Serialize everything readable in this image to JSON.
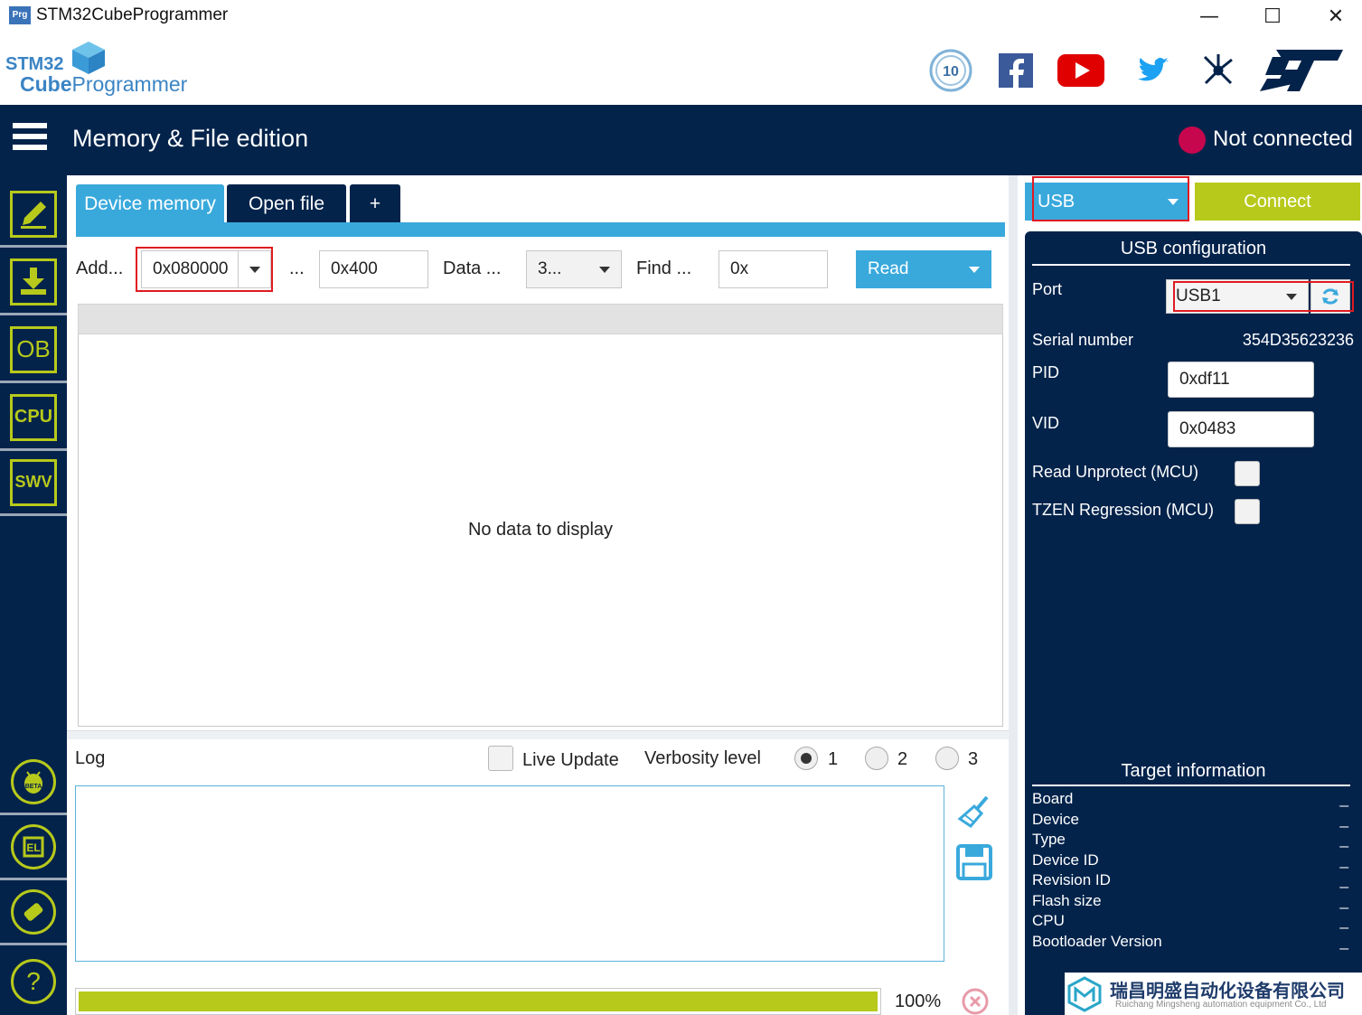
{
  "window": {
    "app_icon_text": "Prg",
    "title": "STM32CubeProgrammer",
    "minimize": "—",
    "maximize": "☐",
    "close": "✕"
  },
  "brand": {
    "logo_stm32": "STM32",
    "logo_cube": "Cube",
    "logo_programmer": "Programmer"
  },
  "header": {
    "page_title": "Memory & File edition",
    "status": "Not connected",
    "status_color": "#c7074d"
  },
  "tabs": [
    {
      "label": "Device memory",
      "active": true
    },
    {
      "label": "Open file",
      "active": false
    },
    {
      "label": "+",
      "active": false
    }
  ],
  "toolbar": {
    "address_label": "Add...",
    "address_value": "0x080000",
    "size_label": "...",
    "size_value": "0x400",
    "data_width_label": "Data ...",
    "data_width_value": "3...",
    "find_label": "Find ...",
    "find_value": "0x",
    "read_button": "Read"
  },
  "memory_view": {
    "empty_message": "No data to display"
  },
  "log": {
    "title": "Log",
    "live_update_label": "Live Update",
    "verbosity_label": "Verbosity level",
    "verbosity_options": [
      "1",
      "2",
      "3"
    ],
    "verbosity_selected": "1",
    "progress_percent_label": "100%",
    "progress_fraction": 1.0
  },
  "connection": {
    "interface": "USB",
    "connect_button": "Connect",
    "config_title": "USB configuration",
    "port_label": "Port",
    "port_value": "USB1",
    "serial_label": "Serial number",
    "serial_value": "354D35623236",
    "pid_label": "PID",
    "pid_value": "0xdf11",
    "vid_label": "VID",
    "vid_value": "0x0483",
    "read_unprotect_label": "Read Unprotect (MCU)",
    "tzen_label": "TZEN Regression (MCU)"
  },
  "target": {
    "title": "Target information",
    "rows": [
      {
        "label": "Board",
        "value": "_"
      },
      {
        "label": "Device",
        "value": "_"
      },
      {
        "label": "Type",
        "value": "_"
      },
      {
        "label": "Device ID",
        "value": "_"
      },
      {
        "label": "Revision ID",
        "value": "_"
      },
      {
        "label": "Flash size",
        "value": "_"
      },
      {
        "label": "CPU",
        "value": "_"
      },
      {
        "label": "Bootloader Version",
        "value": "_"
      }
    ]
  },
  "sidebar": {
    "ob_label": "OB",
    "cpu_label": "CPU",
    "swv_label": "SWV",
    "help_label": "?"
  },
  "social": {
    "tenth_anniversary_label": "10"
  },
  "watermark": {
    "company_cn": "瑞昌明盛自动化设备有限公司",
    "company_en": "Ruichang Mingsheng automation equipment Co., Ltd"
  },
  "colors": {
    "navy": "#03234b",
    "accent_blue": "#39a9dc",
    "accent_green": "#b7c91b",
    "highlight_red": "#e01a22"
  }
}
